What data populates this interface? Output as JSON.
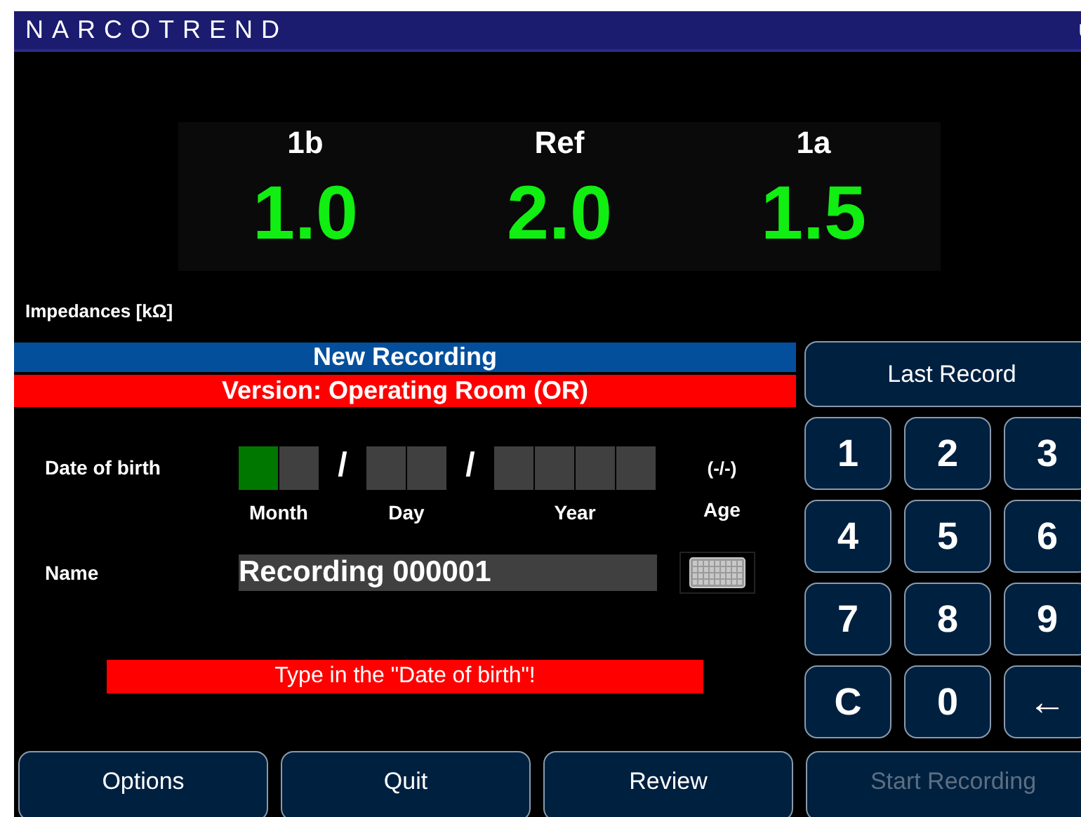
{
  "window": {
    "title": "NARCOTREND"
  },
  "impedances": {
    "channels": [
      {
        "label": "1b",
        "value": "1.0"
      },
      {
        "label": "Ref",
        "value": "2.0"
      },
      {
        "label": "1a",
        "value": "1.5"
      }
    ],
    "caption": "Impedances [kΩ]"
  },
  "header": "New Recording",
  "version": "Version: Operating Room (OR)",
  "date_of_birth": {
    "label": "Date of birth",
    "parts": [
      {
        "label": "Month",
        "cells": [
          {
            "active": true
          },
          {
            "active": false
          }
        ]
      },
      {
        "label": "Day",
        "cells": [
          {
            "active": false
          },
          {
            "active": false
          }
        ]
      },
      {
        "label": "Year",
        "cells": [
          {
            "active": false
          },
          {
            "active": false
          },
          {
            "active": false
          },
          {
            "active": false
          }
        ]
      }
    ],
    "separator": "/",
    "age": "(-/-)",
    "age_label": "Age"
  },
  "name": {
    "label": "Name",
    "value": "Recording 000001"
  },
  "message": "Type in the \"Date of birth\"!",
  "last_record": "Last Record",
  "keypad": [
    "1",
    "2",
    "3",
    "4",
    "5",
    "6",
    "7",
    "8",
    "9",
    "C",
    "0",
    "←"
  ],
  "buttons": [
    {
      "label": "Options",
      "disabled": false
    },
    {
      "label": "Quit",
      "disabled": false
    },
    {
      "label": "Review",
      "disabled": false
    },
    {
      "label": "Start Recording",
      "disabled": true
    }
  ]
}
